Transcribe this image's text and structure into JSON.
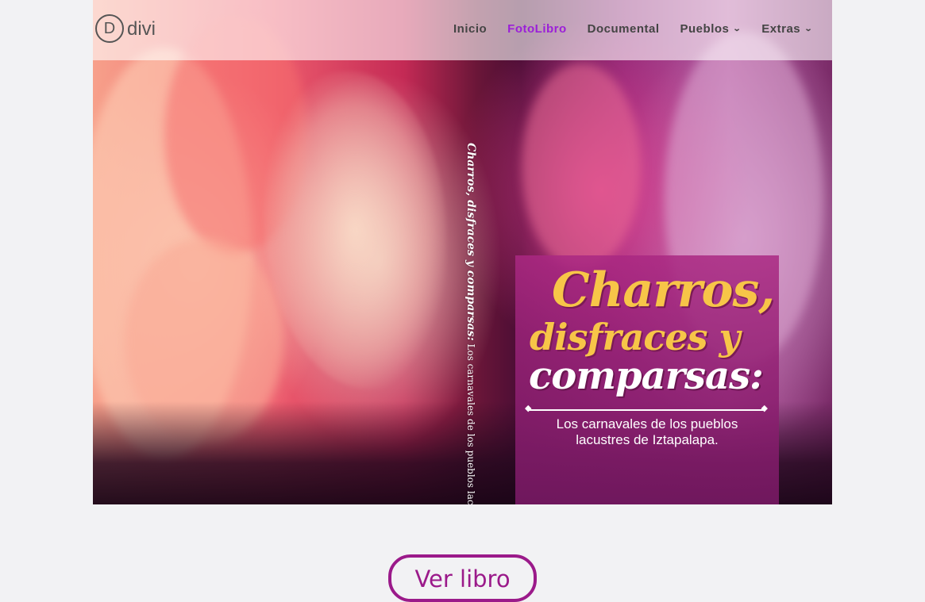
{
  "brand": {
    "logo_letter": "D",
    "logo_text": "divi"
  },
  "nav": {
    "items": [
      {
        "label": "Inicio",
        "active": false,
        "dropdown": false
      },
      {
        "label": "FotoLibro",
        "active": true,
        "dropdown": false
      },
      {
        "label": "Documental",
        "active": false,
        "dropdown": false
      },
      {
        "label": "Pueblos",
        "active": false,
        "dropdown": true
      },
      {
        "label": "Extras",
        "active": false,
        "dropdown": true
      }
    ],
    "active_color": "#9b1fd8"
  },
  "cover": {
    "title_line1": "Charros,",
    "title_line2": "disfraces y",
    "title_line3": "comparsas:",
    "subtitle_line1": "Los carnavales de los pueblos",
    "subtitle_line2": "lacustres de Iztapalapa.",
    "spine_title": "Charros, disfraces y comparsas:",
    "spine_subtitle": "Los carnavales de los pueblos lacustres de Iztapalapa."
  },
  "cta": {
    "label": "Ver libro",
    "color": "#9b1a8a"
  }
}
